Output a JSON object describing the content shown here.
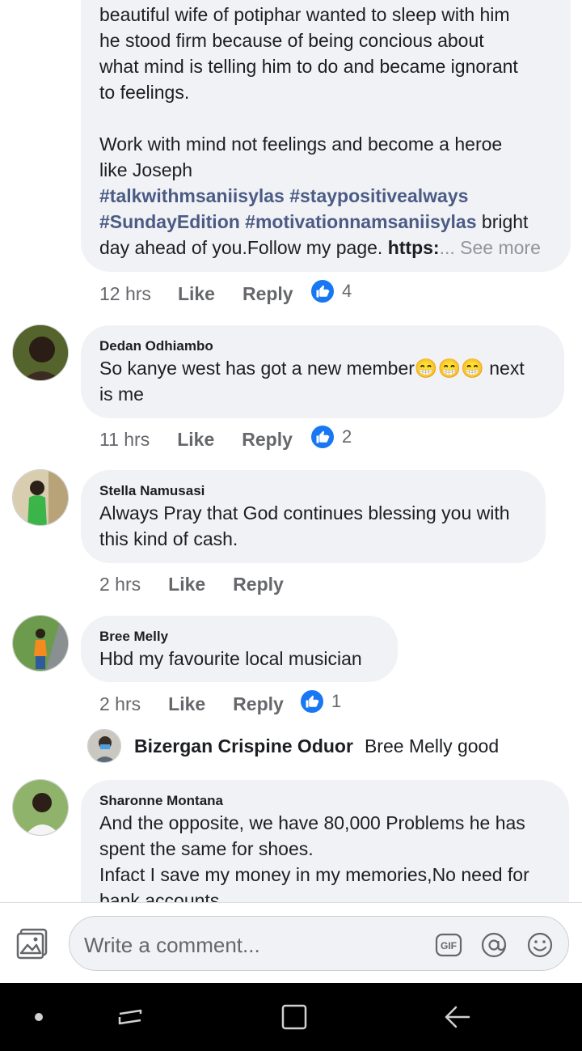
{
  "comments": [
    {
      "author": "",
      "lines_top": "beautiful wife of potiphar wanted to sleep with him",
      "paragraph1": [
        "he stood firm because of being concious about",
        "what mind is telling him to do and became ignorant",
        "to feelings."
      ],
      "paragraph2": [
        "Work with mind not feelings and become a heroe",
        "like Joseph"
      ],
      "hashtags_line1": "#talkwithmsaniisylas #staypositivealways",
      "hashtags_line2": "#SundayEdition #motivationnamsaniisylas",
      "after_hashtag": " bright",
      "last_line_text": "day ahead of you.Follow my page. ",
      "last_line_bold": "https:",
      "see_more": "... See more",
      "time": "12 hrs",
      "like_label": "Like",
      "reply_label": "Reply",
      "like_count": "4"
    },
    {
      "author": "Dedan Odhiambo",
      "line1": "So kanye west has got a new member",
      "emojis": "😁😁😁",
      "line1_end": " next",
      "line2": "is me",
      "time": "11 hrs",
      "like_label": "Like",
      "reply_label": "Reply",
      "like_count": "2"
    },
    {
      "author": "Stella Namusasi",
      "line1": "Always Pray that God continues blessing you with",
      "line2": "this kind of cash.",
      "time": "2 hrs",
      "like_label": "Like",
      "reply_label": "Reply"
    },
    {
      "author": "Bree Melly",
      "line1": "Hbd my favourite local musician",
      "time": "2 hrs",
      "like_label": "Like",
      "reply_label": "Reply",
      "like_count": "1"
    },
    {
      "author": "Sharonne Montana",
      "line1": "And the opposite, we have 80,000 Problems he has",
      "line2": "spent the same for shoes.",
      "line3": "Infact I save my money in my memories,No need for",
      "line4": "bank accounts"
    }
  ],
  "reply_preview": {
    "author": "Bizergan Crispine Oduor",
    "text": "Bree Melly good"
  },
  "composer": {
    "placeholder": "Write a comment..."
  },
  "icons": {
    "like": "thumbs-up-icon",
    "gallery": "photo-gallery-icon",
    "gif": "gif-icon",
    "mention": "at-sign-icon",
    "emoji": "smiley-icon",
    "nav_dot": "dot-icon",
    "recents": "recent-apps-icon",
    "home": "home-square-icon",
    "back": "back-arrow-icon"
  },
  "colors": {
    "like_blue": "#1877f2",
    "hashtag": "#4b5b85",
    "bubble": "#f0f2f5"
  }
}
